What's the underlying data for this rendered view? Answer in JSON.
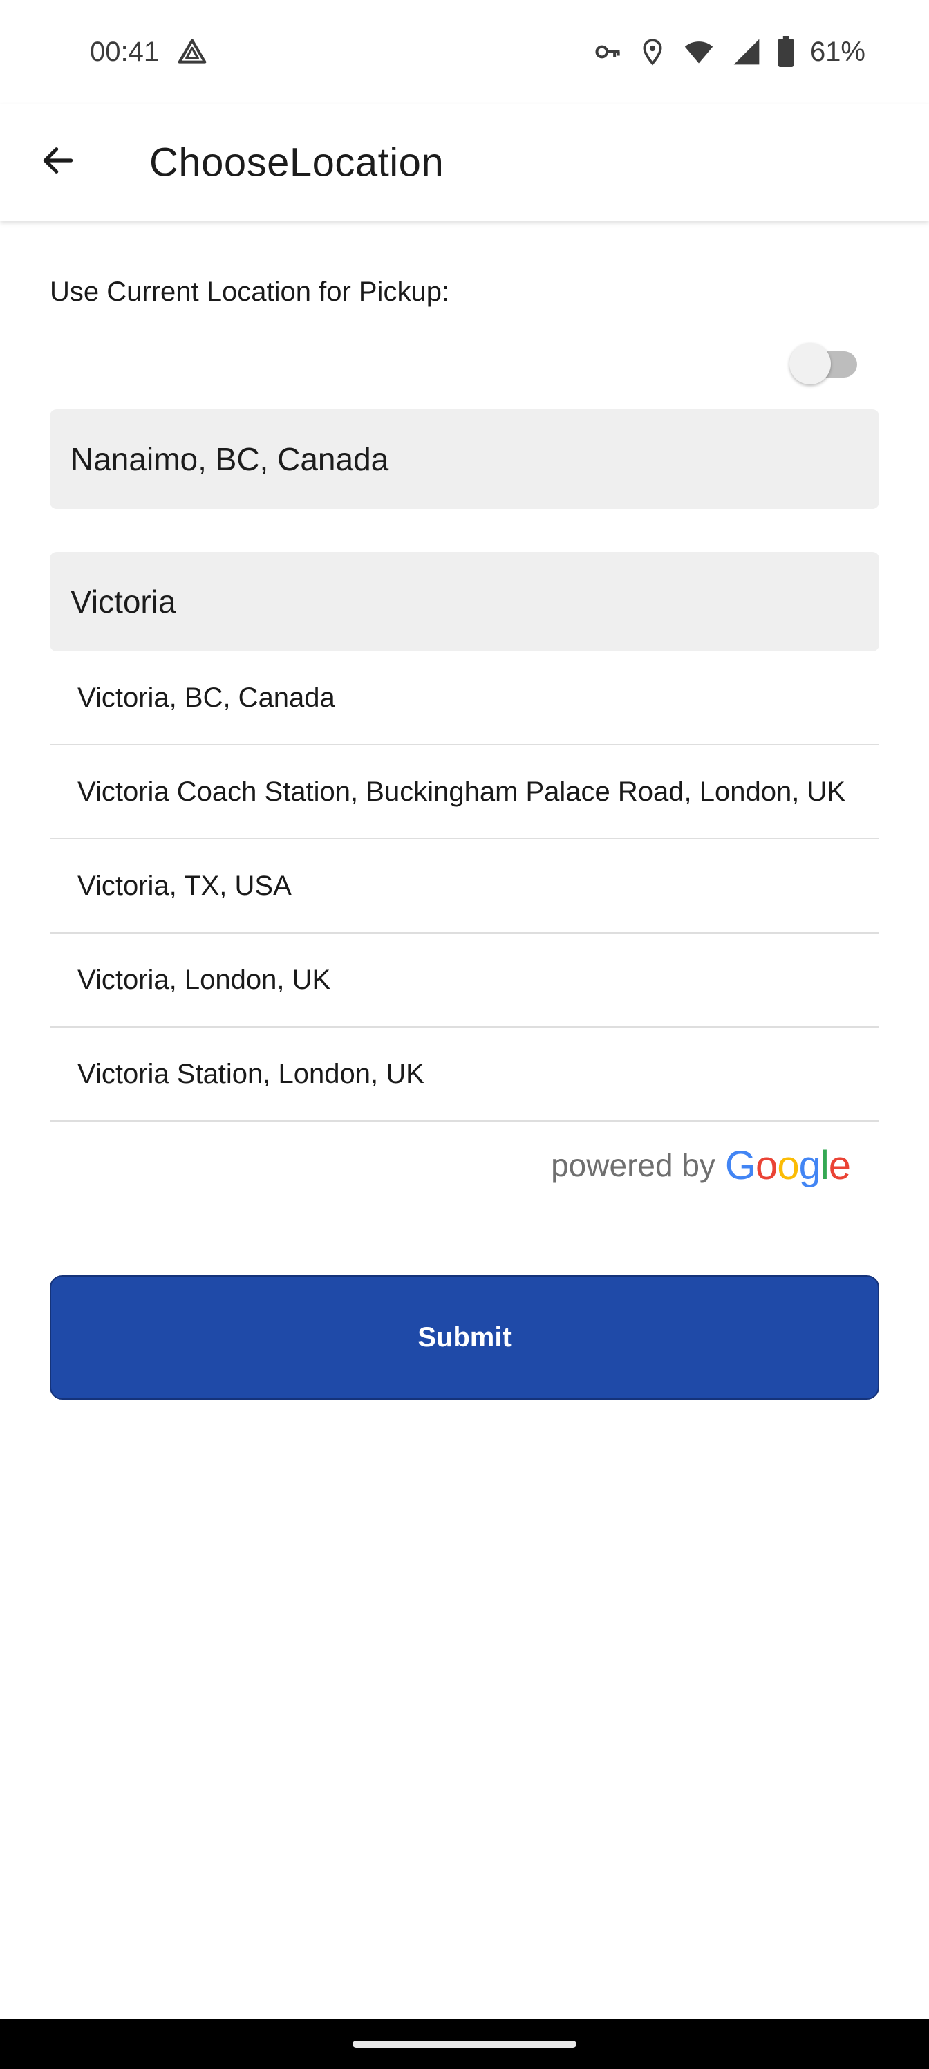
{
  "status_bar": {
    "time": "00:41",
    "battery": "61%",
    "icons": [
      "drive-icon",
      "vpn-key-icon",
      "location-icon",
      "wifi-icon",
      "signal-icon",
      "battery-icon"
    ]
  },
  "app_bar": {
    "title": "ChooseLocation",
    "back_icon": "arrow-back-icon"
  },
  "form": {
    "current_location_label": "Use Current Location for Pickup:",
    "current_location_toggle": false,
    "pickup_value": "Nanaimo, BC, Canada",
    "destination_value": "Victoria",
    "suggestions": [
      "Victoria, BC, Canada",
      "Victoria Coach Station, Buckingham Palace Road, London, UK",
      "Victoria, TX, USA",
      "Victoria, London, UK",
      "Victoria Station, London, UK"
    ],
    "powered_by": "powered by",
    "google_letters": [
      "G",
      "o",
      "o",
      "g",
      "l",
      "e"
    ],
    "google_colors": [
      "#4285F4",
      "#EA4335",
      "#FBBC05",
      "#4285F4",
      "#34A853",
      "#EA4335"
    ],
    "submit_label": "Submit"
  },
  "colors": {
    "submit_bg": "#1f4aa8",
    "input_bg": "#efefef",
    "toggle_track": "#bdbdbd"
  }
}
